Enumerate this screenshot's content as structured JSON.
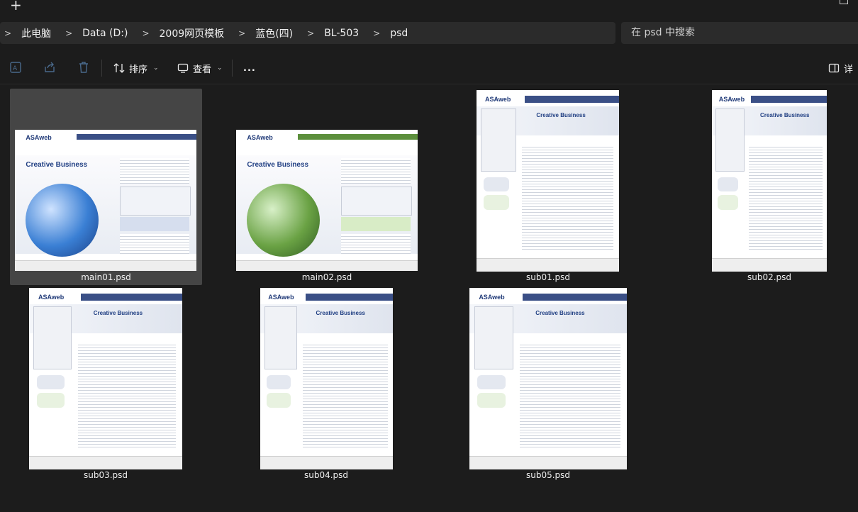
{
  "tabstrip": {
    "new_tab_glyph": "+"
  },
  "breadcrumb": {
    "items": [
      "此电脑",
      "Data (D:)",
      "2009网页模板",
      "蓝色(四)",
      "BL-503",
      "psd"
    ],
    "separator": ">"
  },
  "search": {
    "placeholder": "在 psd 中搜索"
  },
  "toolbar": {
    "icons": [
      "rename-icon",
      "share-icon",
      "delete-icon"
    ],
    "sort_label": "排序",
    "view_label": "查看",
    "more_glyph": "...",
    "details_label": "详"
  },
  "files": [
    {
      "name": "main01.psd",
      "selected": true,
      "accent": "#3a4f86",
      "theme": "blue"
    },
    {
      "name": "main02.psd",
      "selected": false,
      "accent": "#5c8f3c",
      "theme": "green"
    },
    {
      "name": "sub01.psd",
      "selected": false,
      "accent": "#3a4f86",
      "theme": "blue"
    },
    {
      "name": "sub02.psd",
      "selected": false,
      "accent": "#3a4f86",
      "theme": "blue"
    },
    {
      "name": "sub03.psd",
      "selected": false,
      "accent": "#3a4f86",
      "theme": "blue"
    },
    {
      "name": "sub04.psd",
      "selected": false,
      "accent": "#3a4f86",
      "theme": "blue"
    },
    {
      "name": "sub05.psd",
      "selected": false,
      "accent": "#3a4f86",
      "theme": "blue"
    }
  ],
  "thumb_text": {
    "logo": "ASAweb",
    "headline": "Creative Business"
  },
  "colors": {
    "background": "#1c1c1c",
    "panel": "#2b2b2b",
    "selected": "#454545"
  }
}
